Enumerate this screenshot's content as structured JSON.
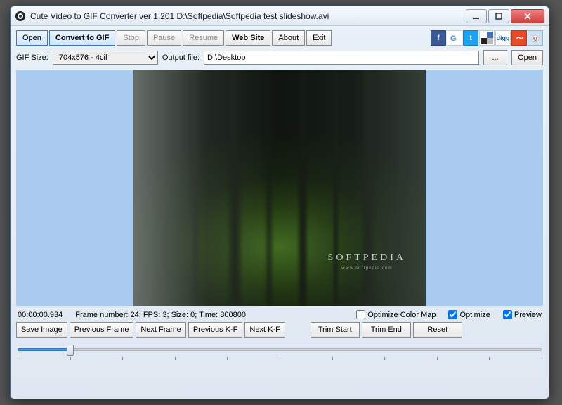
{
  "window": {
    "title": "Cute Video to GIF Converter ver 1.201   D:\\Softpedia\\Softpedia test slideshow.avi"
  },
  "toolbar": {
    "open": "Open",
    "convert": "Convert to GIF",
    "stop": "Stop",
    "pause": "Pause",
    "resume": "Resume",
    "website": "Web Site",
    "about": "About",
    "exit": "Exit"
  },
  "row2": {
    "gif_size_label": "GIF Size:",
    "gif_size_value": "704x576 - 4cif",
    "output_label": "Output file:",
    "output_value": "D:\\Desktop",
    "browse": "...",
    "open2": "Open"
  },
  "watermark": {
    "main": "SOFTPEDIA",
    "sub": "www.softpedia.com"
  },
  "status": {
    "time": "00:00:00.934",
    "frame_info": "Frame number: 24; FPS: 3; Size: 0; Time: 800800",
    "opt_color_map": "Optimize Color Map",
    "optimize": "Optimize",
    "preview": "Preview",
    "opt_color_checked": false,
    "optimize_checked": true,
    "preview_checked": true
  },
  "controls": {
    "save_image": "Save Image",
    "prev_frame": "Previous Frame",
    "next_frame": "Next Frame",
    "prev_kf": "Previous K-F",
    "next_kf": "Next K-F",
    "trim_start": "Trim Start",
    "trim_end": "Trim End",
    "reset": "Reset"
  },
  "social_icons": [
    "facebook",
    "google",
    "twitter",
    "delicious",
    "digg",
    "stumbleupon",
    "reddit"
  ]
}
